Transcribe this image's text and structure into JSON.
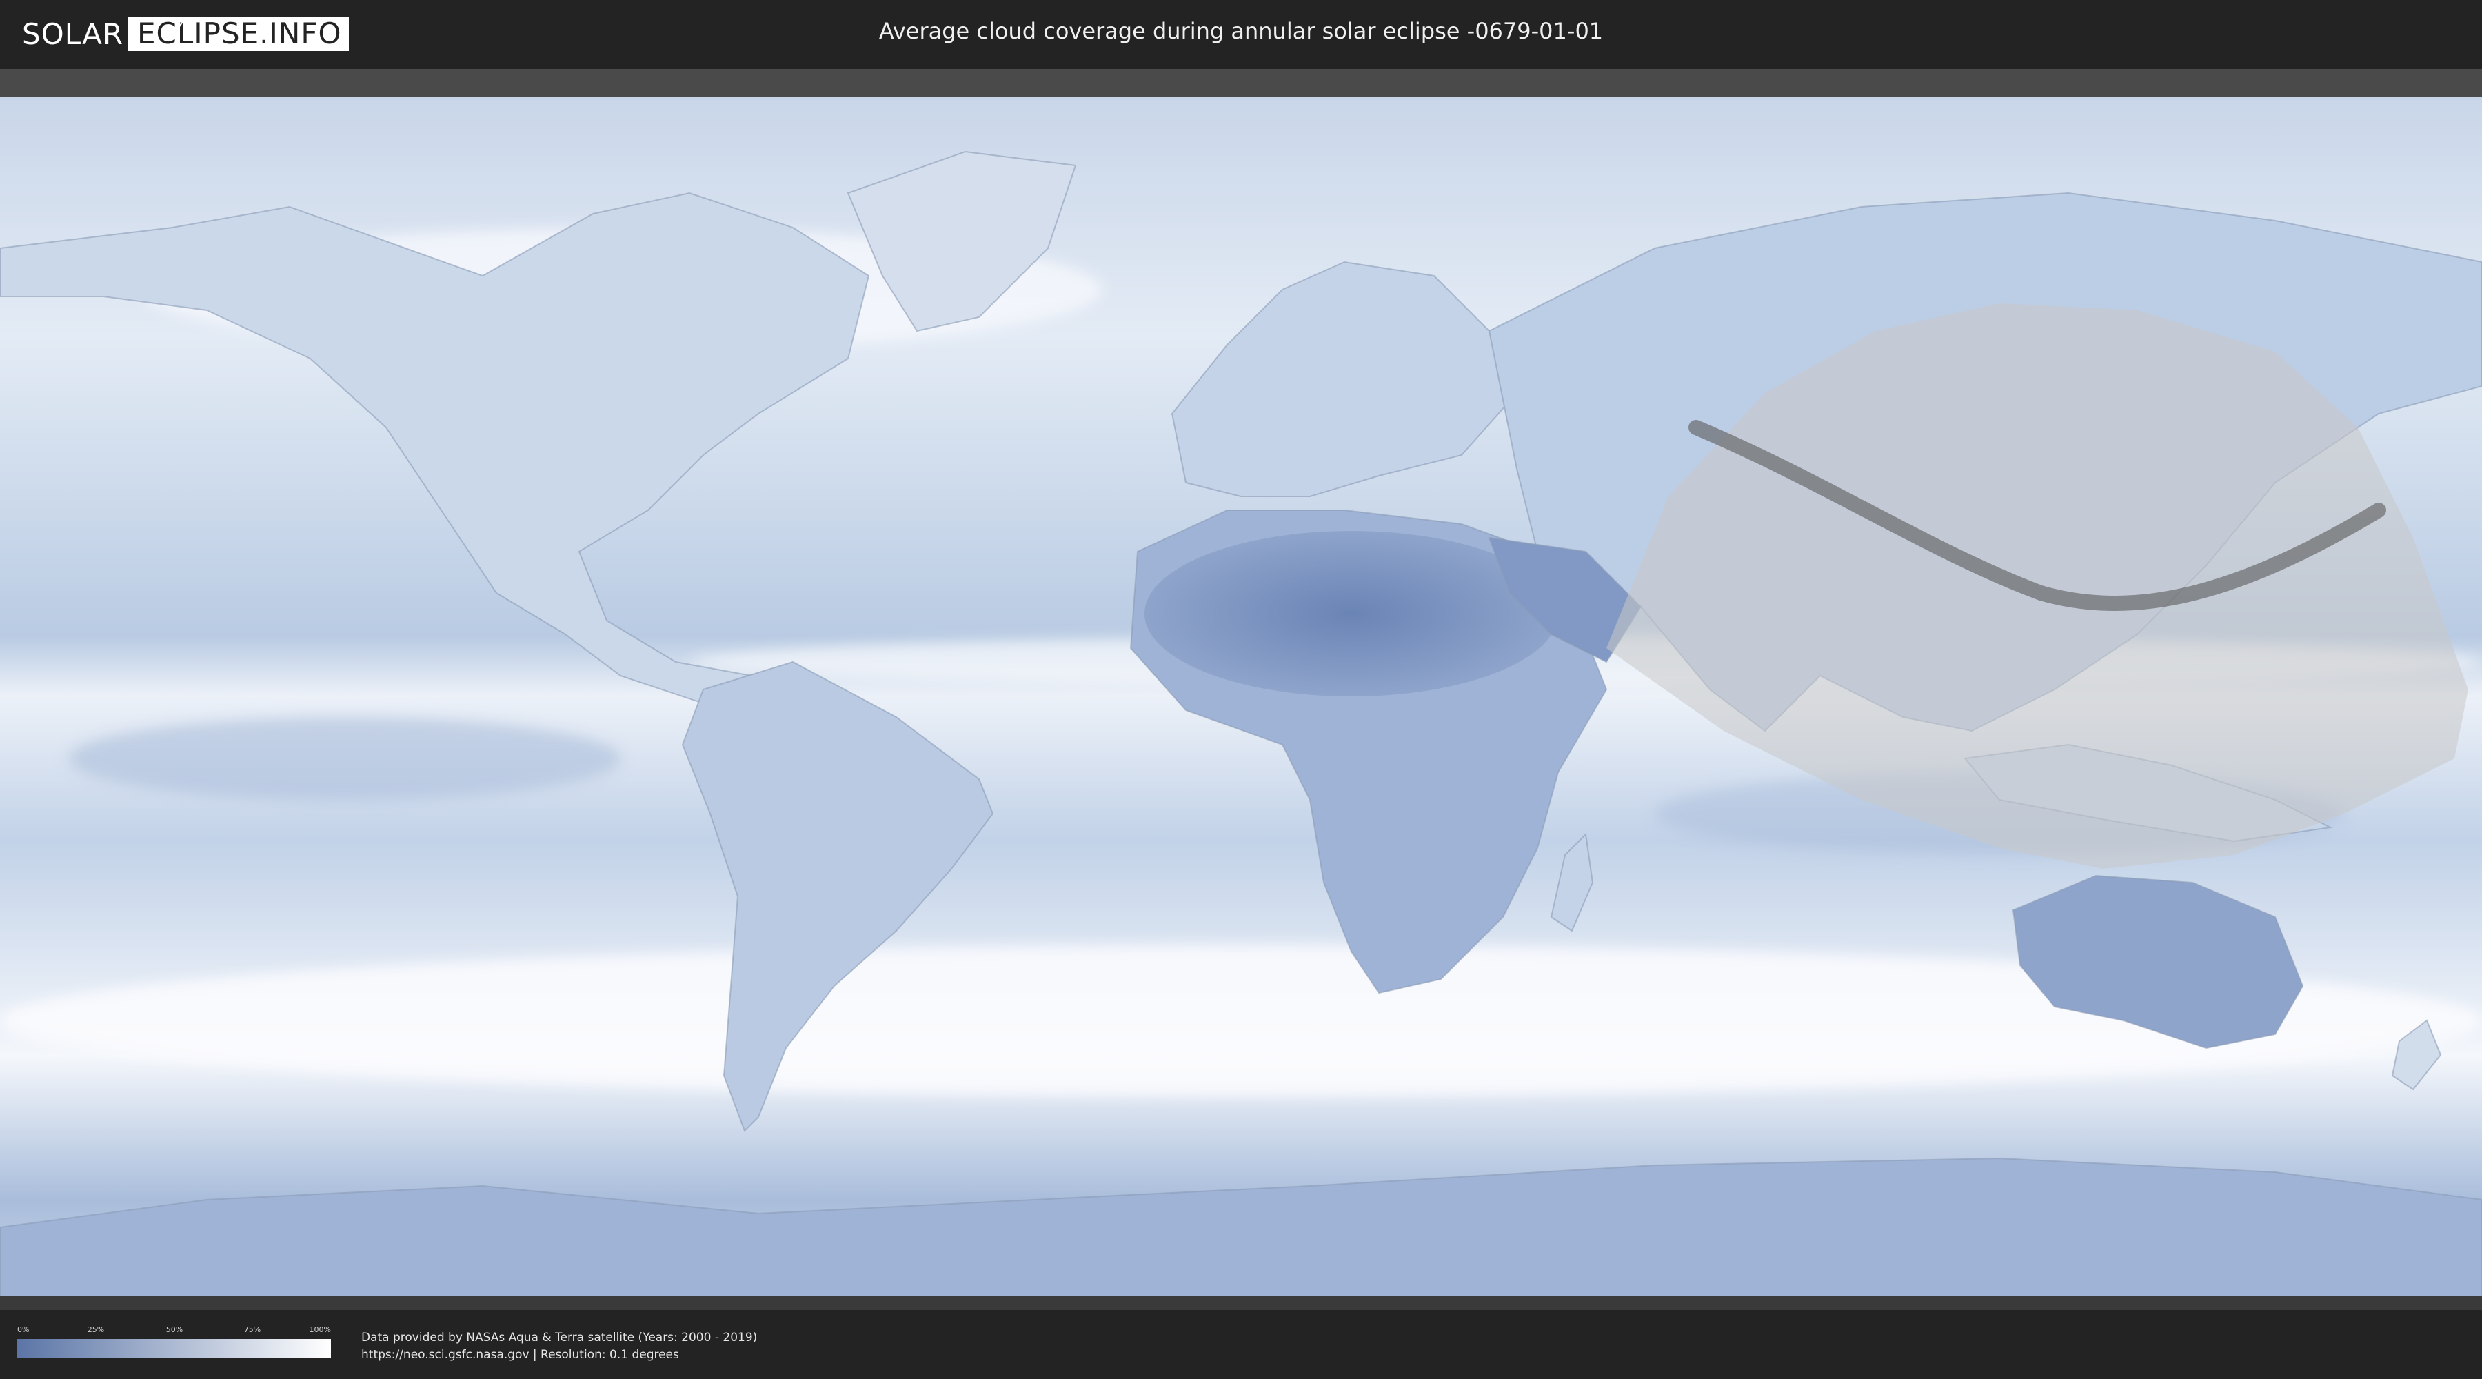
{
  "header": {
    "logo_left": "SOLAR",
    "logo_right": "ECLIPSE.INFO",
    "title": "Average cloud coverage during annular solar eclipse -0679-01-01"
  },
  "legend": {
    "ticks": [
      "0%",
      "25%",
      "50%",
      "75%",
      "100%"
    ],
    "color_low": "#5b75a6",
    "color_high": "#ffffff"
  },
  "credits": {
    "line1": "Data provided by NASAs Aqua & Terra satellite (Years: 2000 - 2019)",
    "line2": "https://neo.sci.gsfc.nasa.gov | Resolution: 0.1 degrees"
  },
  "colors": {
    "background": "#232323",
    "ocean_cloud": "#dfe7f2",
    "clear_sky": "#6f87b6",
    "eclipse_zone": "#c8c8c8",
    "central_path": "#5a5a5a"
  },
  "icons": {
    "logo": "sun-flare-icon"
  }
}
